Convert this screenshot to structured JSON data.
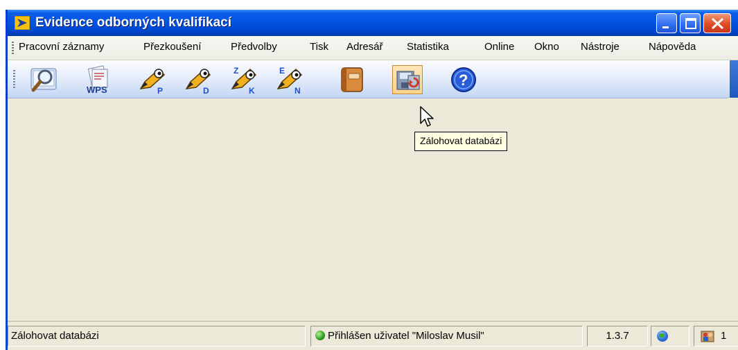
{
  "window": {
    "title": "Evidence odborných kvalifikací"
  },
  "menu": {
    "items": [
      "Pracovní záznamy",
      "Přezkoušení",
      "Předvolby",
      "Tisk",
      "Adresář",
      "Statistika",
      "Online",
      "Okno",
      "Nástroje",
      "Nápověda"
    ]
  },
  "toolbar": {
    "buttons": [
      {
        "name": "search-records",
        "icon": "magnifier-icon"
      },
      {
        "name": "wps",
        "icon": "wps-document-icon",
        "label": "WPS"
      },
      {
        "name": "exam-p",
        "icon": "pencil-icon",
        "letter": "P"
      },
      {
        "name": "exam-d",
        "icon": "pencil-icon",
        "letter": "D"
      },
      {
        "name": "exam-zk",
        "icon": "pencil-icon",
        "letters": [
          "Z",
          "K"
        ]
      },
      {
        "name": "exam-en",
        "icon": "pencil-icon",
        "letters": [
          "E",
          "N"
        ]
      },
      {
        "name": "address-book",
        "icon": "book-icon"
      },
      {
        "name": "backup-database",
        "icon": "backup-icon",
        "active": true
      },
      {
        "name": "help",
        "icon": "help-icon"
      }
    ]
  },
  "tooltip": {
    "text": "Zálohovat databázi"
  },
  "status": {
    "message": "Zálohovat databázi",
    "user": "Přihlášen uživatel \"Miloslav Musil\"",
    "version": "1.3.7",
    "count": "1"
  },
  "colors": {
    "titlebar": "#0054E3",
    "client_background": "#ECE9D8",
    "tooltip_background": "#FFFFE1",
    "active_button": "#FBD38C"
  }
}
